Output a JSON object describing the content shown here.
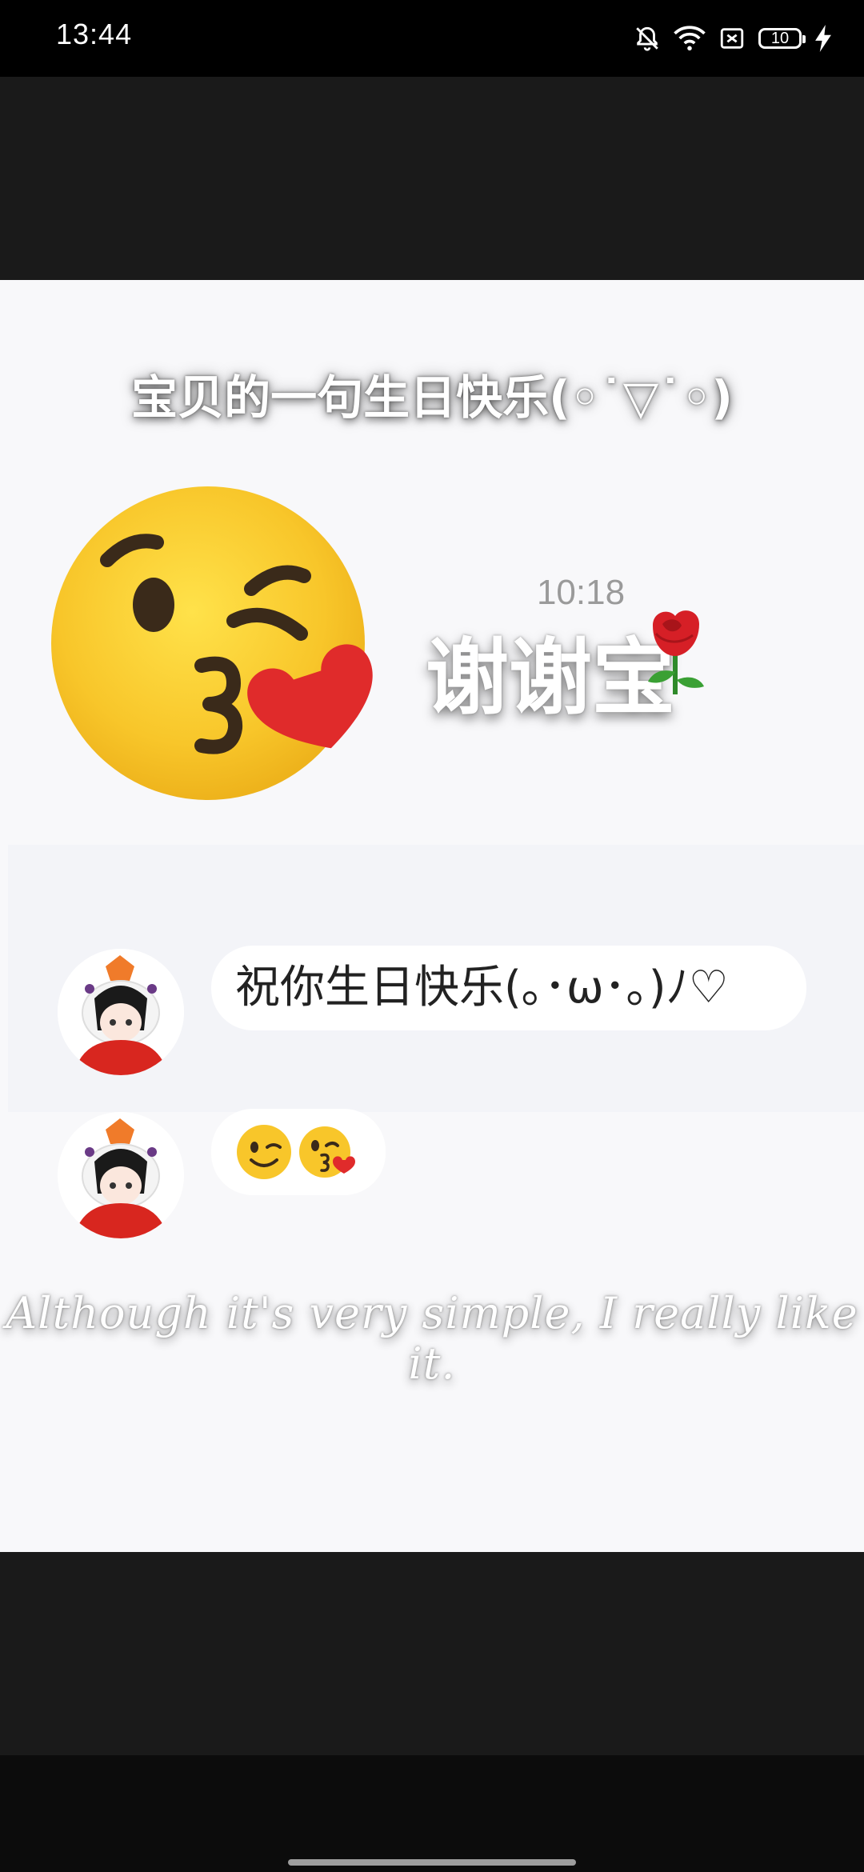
{
  "status_bar": {
    "time": "13:44",
    "battery_level": "10",
    "icons": [
      "bell-off-icon",
      "wifi-icon",
      "sim-blocked-icon",
      "battery-icon",
      "charging-bolt-icon"
    ]
  },
  "image": {
    "headline": "宝贝的一句生日快乐(◦˙▽˙◦)",
    "thanks": "谢谢宝",
    "decor_icons": [
      "kissing-face-emoji",
      "rose-emoji"
    ],
    "chat": {
      "time": "10:18",
      "messages": [
        {
          "type": "text",
          "text": "祝你生日快乐(｡･ω･｡)ﾉ♡"
        },
        {
          "type": "emoji",
          "emojis": [
            "winking-face-emoji",
            "face-blowing-kiss-emoji"
          ]
        }
      ]
    },
    "tagline": "Although it's very simple, I really like it."
  },
  "colors": {
    "background": "#f8f8fa",
    "chat_panel": "#f3f4f8",
    "bubble": "#ffffff",
    "emoji_yellow": "#f7c325",
    "kiss_heart": "#e02b2b"
  }
}
